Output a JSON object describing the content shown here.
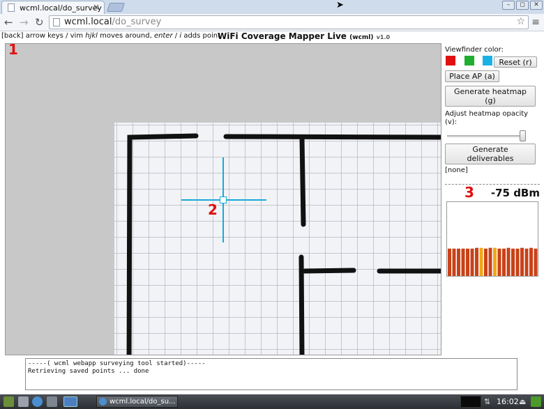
{
  "browser": {
    "tab_title": "wcml.local/do_survey",
    "tab_close": "×",
    "url_host": "wcml.local",
    "url_path": "/do_survey",
    "win_min": "–",
    "win_max": "◻",
    "win_close": "✕"
  },
  "page": {
    "help_prefix": "[back] arrow keys / vim ",
    "help_keys": "hjkl",
    "help_mid": " moves around, ",
    "help_enter": "enter",
    "help_slash": " / ",
    "help_i": "i",
    "help_suffix": " adds point",
    "title": "WiFi Coverage Mapper Live",
    "title_abbr": "(wcml)",
    "version": "v1.0"
  },
  "markers": {
    "viewport": "1",
    "crosshair": "2",
    "signal": "3"
  },
  "panel": {
    "viewfinder_label": "Viewfinder color:",
    "colors": [
      "#e01010",
      "#1fae2e",
      "#1ab2e6"
    ],
    "reset_button": "Reset (r)",
    "place_ap_button": "Place AP (a)",
    "heatmap_button": "Generate heatmap (g)",
    "opacity_label": "Adjust heatmap opacity (v):",
    "opacity_value": 0.97,
    "deliverables_button": "Generate deliverables",
    "deliverables_status": "[none]",
    "signal_value": "-75 dBm",
    "meter_levels": [
      0.37,
      0.37,
      0.37,
      0.37,
      0.37,
      0.37,
      0.38,
      0.38,
      0.37,
      0.38,
      0.38,
      0.37,
      0.37,
      0.38,
      0.37,
      0.37,
      0.38,
      0.37,
      0.38,
      0.37
    ],
    "meter_highlight": [
      7,
      10
    ]
  },
  "console": {
    "lines": [
      "-----( wcml webapp surveying tool started)-----",
      "Retrieving saved points ... done"
    ]
  },
  "taskbar": {
    "task_label": "wcml.local/do_su...",
    "clock": "16:02"
  }
}
